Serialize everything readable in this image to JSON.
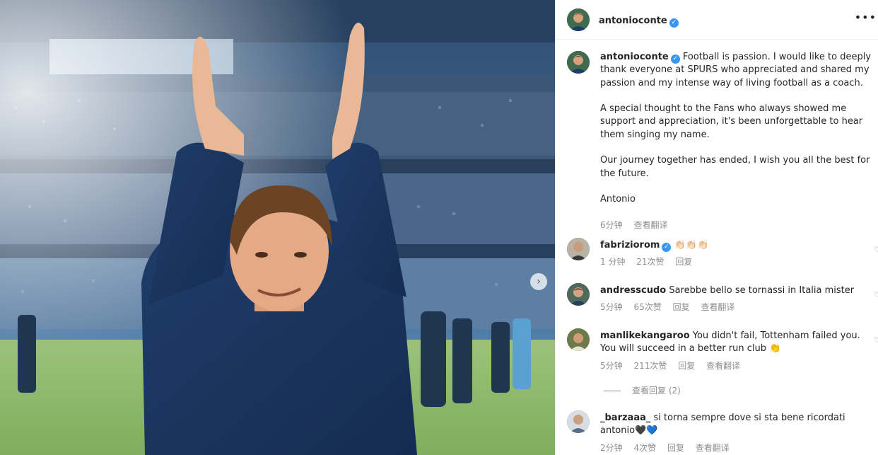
{
  "post": {
    "username": "antonioconte",
    "caption_paragraphs": [
      "Football is passion. I would like to deeply thank everyone at SPURS who appreciated and shared my passion and my intense way of living football as a coach.",
      "A special thought to the Fans who always showed me support and appreciation, it's been unforgettable to hear them singing my name.",
      "Our journey together has ended, I wish you all the best for the future.",
      "Antonio"
    ],
    "time": "6分钟",
    "translate": "查看翻译"
  },
  "comments": [
    {
      "username": "fabriziorom",
      "verified": true,
      "text": "👏🏻👏🏻👏🏻",
      "time": "1 分钟",
      "likes": "21次赞",
      "reply": "回复"
    },
    {
      "username": "andresscudo",
      "verified": false,
      "text": "Sarebbe bello se tornassi in Italia mister",
      "time": "5分钟",
      "likes": "65次赞",
      "reply": "回复",
      "translate": "查看翻译"
    },
    {
      "username": "manlikekangaroo",
      "verified": false,
      "text": "You didn't fail, Tottenham failed you. You will succeed in a better run club 👏",
      "time": "5分钟",
      "likes": "211次赞",
      "reply": "回复",
      "translate": "查看翻译",
      "view_replies": "查看回复 (2)"
    },
    {
      "username": "_barzaaa_",
      "verified": false,
      "text": "si torna sempre dove si sta bene ricordati antonio🖤💙",
      "time": "2分钟",
      "likes": "4次赞",
      "reply": "回复",
      "translate": "查看翻译"
    }
  ],
  "icons": {
    "verified": "verified-badge-icon",
    "more": "more-options-icon",
    "next": "chevron-right-icon",
    "like": "heart-icon"
  },
  "glyphs": {
    "more": "•••",
    "next": "›",
    "verified_check": "✓",
    "like": "♡"
  },
  "colors": {
    "verified": "#3897f0",
    "meta_text": "#8e8e8e",
    "border": "#efefef"
  }
}
